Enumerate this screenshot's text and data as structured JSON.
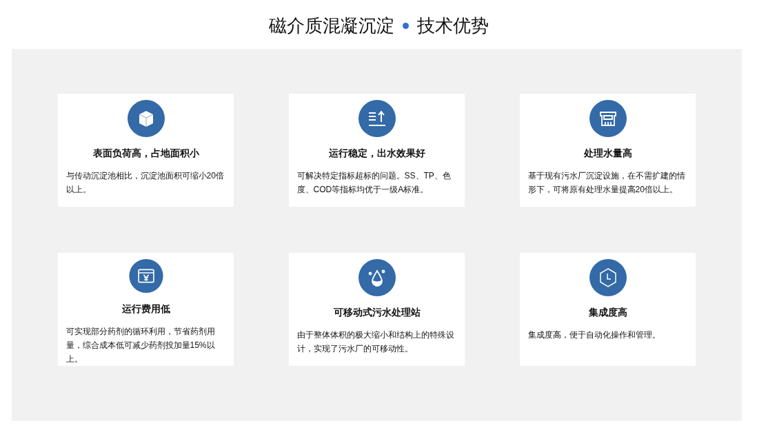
{
  "title": {
    "main": "磁介质混凝沉淀",
    "sub": "技术优势"
  },
  "features": [
    {
      "title": "表面负荷高，占地面积小",
      "text": "与传动沉淀池相比，沉淀池面积可缩小20倍以上。"
    },
    {
      "title": "运行稳定，出水效果好",
      "text": "可解决特定指标超标的问题。SS、TP、色度、COD等指标均优于一级A标准。"
    },
    {
      "title": "处理水量高",
      "text": "基于现有污水厂沉淀设施，在不需扩建的情形下，可将原有处理水量提高20倍以上。"
    },
    {
      "title": "运行费用低",
      "text": "可实现部分药剂的循环利用，节省药剂用量，综合成本低可减少药剂投加量15%以上。"
    },
    {
      "title": "可移动式污水处理站",
      "text": "由于整体体积的极大缩小和结构上的特殊设计，实现了污水厂的可移动性。"
    },
    {
      "title": "集成度高",
      "text": "集成度高，便于自动化操作和管理。"
    }
  ]
}
